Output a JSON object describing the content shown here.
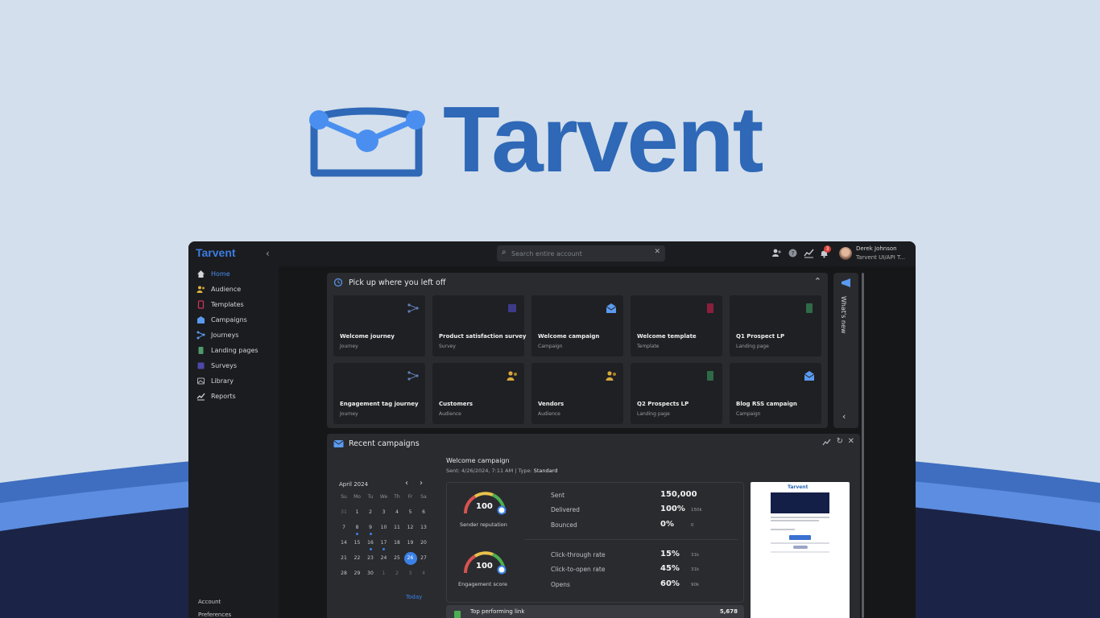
{
  "brand": {
    "name": "Tarvent"
  },
  "colors": {
    "brand_blue": "#2e68b7",
    "accent": "#3b82e8",
    "app_bg": "#1d1e21",
    "panel_bg": "#2a2b2f"
  },
  "topbar": {
    "logo": "Tarvent",
    "search_placeholder": "Search entire account",
    "notification_count": "3",
    "user_name": "Derek Johnson",
    "user_org": "Tarvent UI/API T..."
  },
  "sidebar": {
    "items": [
      {
        "label": "Home",
        "icon": "home-icon",
        "active": true
      },
      {
        "label": "Audience",
        "icon": "audience-icon"
      },
      {
        "label": "Templates",
        "icon": "templates-icon"
      },
      {
        "label": "Campaigns",
        "icon": "campaigns-icon"
      },
      {
        "label": "Journeys",
        "icon": "journeys-icon"
      },
      {
        "label": "Landing pages",
        "icon": "landing-pages-icon"
      },
      {
        "label": "Surveys",
        "icon": "surveys-icon"
      },
      {
        "label": "Library",
        "icon": "library-icon"
      },
      {
        "label": "Reports",
        "icon": "reports-icon"
      }
    ],
    "bottom": [
      "Account",
      "Preferences"
    ]
  },
  "pickup": {
    "title": "Pick up where you left off",
    "cards": [
      {
        "title": "Welcome journey",
        "type": "Journey",
        "icon": "journey-icon"
      },
      {
        "title": "Product satisfaction survey",
        "type": "Survey",
        "icon": "survey-icon"
      },
      {
        "title": "Welcome campaign",
        "type": "Campaign",
        "icon": "campaign-icon"
      },
      {
        "title": "Welcome template",
        "type": "Template",
        "icon": "template-icon"
      },
      {
        "title": "Q1 Prospect LP",
        "type": "Landing page",
        "icon": "landing-page-icon"
      },
      {
        "title": "Engagement tag journey",
        "type": "Journey",
        "icon": "journey-icon"
      },
      {
        "title": "Customers",
        "type": "Audience",
        "icon": "audience-icon"
      },
      {
        "title": "Vendors",
        "type": "Audience",
        "icon": "audience-icon"
      },
      {
        "title": "Q2 Prospects LP",
        "type": "Landing page",
        "icon": "landing-page-icon"
      },
      {
        "title": "Blog RSS campaign",
        "type": "Campaign",
        "icon": "campaign-icon"
      }
    ]
  },
  "whats_new": {
    "label": "What's new"
  },
  "recent": {
    "title": "Recent campaigns",
    "calendar": {
      "month": "April 2024",
      "days_of_week": [
        "Su",
        "Mo",
        "Tu",
        "We",
        "Th",
        "Fr",
        "Sa"
      ],
      "weeks": [
        [
          "31",
          "1",
          "2",
          "3",
          "4",
          "5",
          "6"
        ],
        [
          "7",
          "8",
          "9",
          "10",
          "11",
          "12",
          "13"
        ],
        [
          "14",
          "15",
          "16",
          "17",
          "18",
          "19",
          "20"
        ],
        [
          "21",
          "22",
          "23",
          "24",
          "25",
          "26",
          "27"
        ],
        [
          "28",
          "29",
          "30",
          "1",
          "2",
          "3",
          "4"
        ]
      ],
      "selected": "26",
      "today_label": "Today"
    },
    "campaign": {
      "name": "Welcome campaign",
      "sent_prefix": "Sent: 4/26/2024, 7:11 AM | Type: ",
      "type": "Standard"
    },
    "sender_reputation": {
      "score": "100",
      "label": "Sender reputation"
    },
    "engagement_score": {
      "score": "100",
      "label": "Engagement score"
    },
    "metrics": [
      {
        "label": "Sent",
        "value": "150,000",
        "sub": ""
      },
      {
        "label": "Delivered",
        "value": "100%",
        "sub": "150k"
      },
      {
        "label": "Bounced",
        "value": "0%",
        "sub": "0"
      },
      {
        "label": "Click-through rate",
        "value": "15%",
        "sub": "31k"
      },
      {
        "label": "Click-to-open rate",
        "value": "45%",
        "sub": "31k"
      },
      {
        "label": "Opens",
        "value": "60%",
        "sub": "90k"
      }
    ],
    "top_link": {
      "label": "Top performing link",
      "value": "5,678"
    },
    "preview_brand": "Tarvent"
  }
}
